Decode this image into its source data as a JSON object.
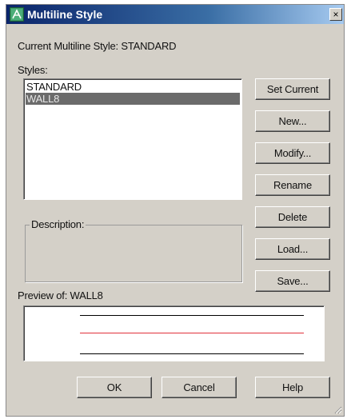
{
  "window": {
    "title": "Multiline Style",
    "close_glyph": "×"
  },
  "current_style_label": "Current Multiline Style: STANDARD",
  "styles": {
    "label": "Styles:",
    "items": [
      {
        "label": "STANDARD",
        "selected": false
      },
      {
        "label": "WALL8",
        "selected": true
      }
    ]
  },
  "buttons": {
    "set_current": "Set Current",
    "new": "New...",
    "modify": "Modify...",
    "rename": "Rename",
    "delete": "Delete",
    "load": "Load...",
    "save": "Save..."
  },
  "description": {
    "label": "Description:",
    "value": ""
  },
  "preview": {
    "label": "Preview of: WALL8",
    "lines": [
      {
        "color": "#000000"
      },
      {
        "color": "#e0303a"
      },
      {
        "color": "#000000"
      }
    ]
  },
  "footer": {
    "ok": "OK",
    "cancel": "Cancel",
    "help": "Help"
  },
  "colors": {
    "titlebar_start": "#0a246a",
    "selection": "#6b6b6b",
    "dialog_bg": "#d4d0c8",
    "center_line": "#e0303a"
  }
}
